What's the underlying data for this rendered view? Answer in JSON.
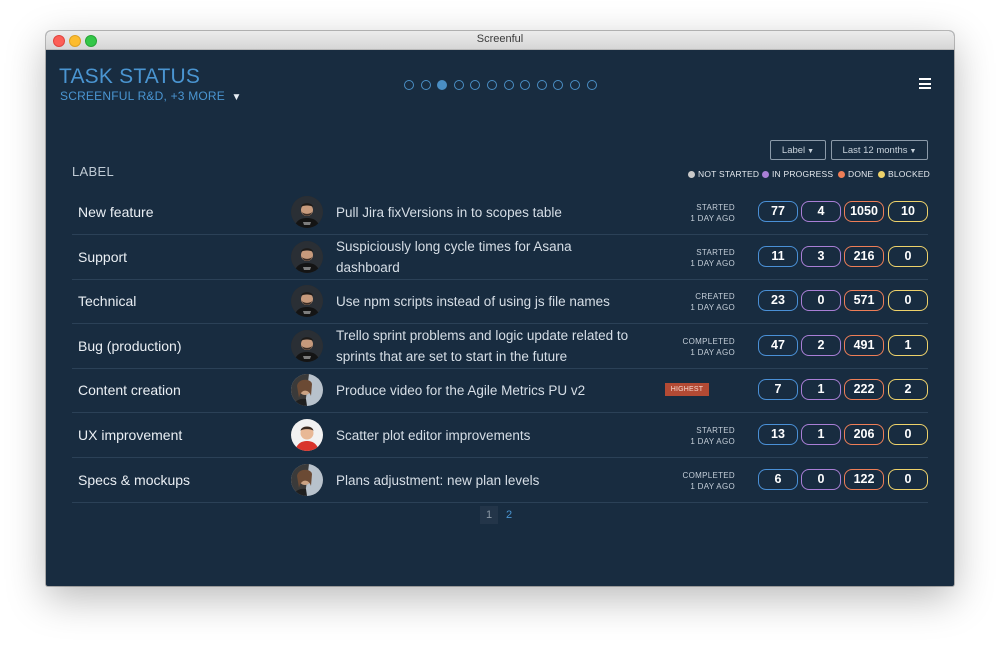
{
  "window": {
    "title": "Screenful"
  },
  "header": {
    "title": "TASK STATUS",
    "subtitle": "SCREENFUL R&D, +3 MORE",
    "pager_dots": 12,
    "active_dot": 2
  },
  "filters": {
    "label_dropdown": "Label",
    "period_dropdown": "Last 12 months"
  },
  "table": {
    "column_header": "LABEL",
    "legend": [
      {
        "label": "NOT STARTED",
        "color": "#c9c9c9"
      },
      {
        "label": "IN PROGRESS",
        "color": "#a97fd6"
      },
      {
        "label": "DONE",
        "color": "#ee7e57"
      },
      {
        "label": "BLOCKED",
        "color": "#eed26a"
      }
    ],
    "status_colors": {
      "not_started": "#4a90d6",
      "in_progress": "#a97fd6",
      "done": "#ee7e57",
      "blocked": "#eed26a"
    },
    "rows": [
      {
        "label": "New feature",
        "avatar": "man-beard",
        "task": "Pull Jira fixVersions in to scopes table",
        "status_line1": "STARTED",
        "status_line2": "1 DAY AGO",
        "priority": "",
        "not_started": "77",
        "in_progress": "4",
        "done": "1050",
        "blocked": "10"
      },
      {
        "label": "Support",
        "avatar": "man-beard",
        "task": "Suspiciously long cycle times for Asana dashboard",
        "status_line1": "STARTED",
        "status_line2": "1 DAY AGO",
        "priority": "",
        "not_started": "11",
        "in_progress": "3",
        "done": "216",
        "blocked": "0"
      },
      {
        "label": "Technical",
        "avatar": "man-beard",
        "task": "Use npm scripts instead of using js file names",
        "status_line1": "CREATED",
        "status_line2": "1 DAY AGO",
        "priority": "",
        "not_started": "23",
        "in_progress": "0",
        "done": "571",
        "blocked": "0"
      },
      {
        "label": "Bug (production)",
        "avatar": "man-beard",
        "task": "Trello sprint problems and logic update related to sprints that are set to start in the future",
        "status_line1": "COMPLETED",
        "status_line2": "1 DAY AGO",
        "priority": "",
        "not_started": "47",
        "in_progress": "2",
        "done": "491",
        "blocked": "1"
      },
      {
        "label": "Content creation",
        "avatar": "woman",
        "task": "Produce video for the Agile Metrics PU v2",
        "status_line1": "",
        "status_line2": "",
        "priority": "HIGHEST",
        "not_started": "7",
        "in_progress": "1",
        "done": "222",
        "blocked": "2"
      },
      {
        "label": "UX improvement",
        "avatar": "man-red-shirt",
        "task": "Scatter plot editor improvements",
        "status_line1": "STARTED",
        "status_line2": "1 DAY AGO",
        "priority": "",
        "not_started": "13",
        "in_progress": "1",
        "done": "206",
        "blocked": "0"
      },
      {
        "label": "Specs & mockups",
        "avatar": "woman",
        "task": "Plans adjustment: new plan levels",
        "status_line1": "COMPLETED",
        "status_line2": "1 DAY AGO",
        "priority": "",
        "not_started": "6",
        "in_progress": "0",
        "done": "122",
        "blocked": "0"
      }
    ]
  },
  "pagination": {
    "pages": [
      "1",
      "2"
    ],
    "current": "1"
  },
  "icons": {
    "filter": "filter-icon",
    "menu": "hamburger-menu-icon",
    "caret": "caret-down-icon"
  }
}
